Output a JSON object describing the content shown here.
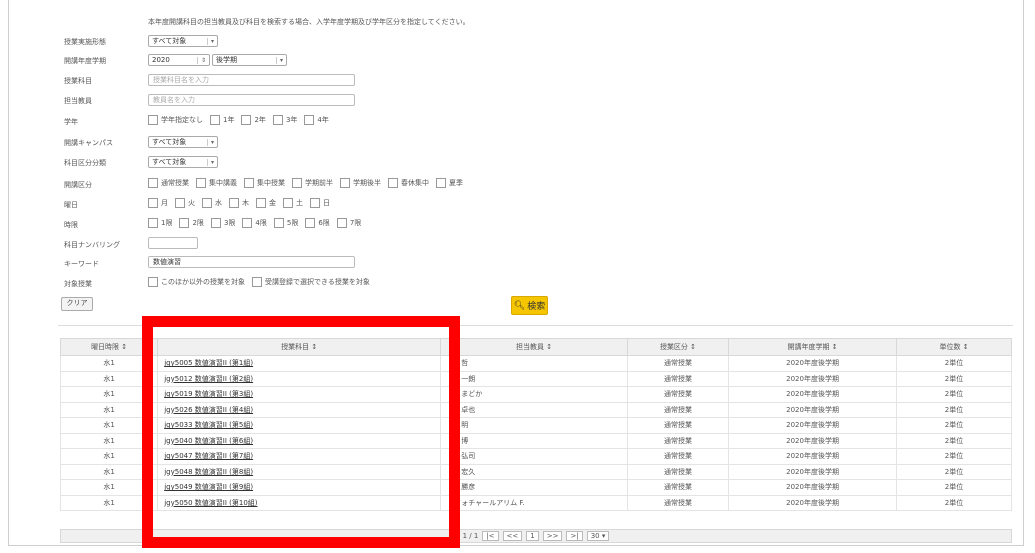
{
  "form": {
    "hint": "本年度開講科目の担当教員及び科目を検索する場合、入学年度学期及び学年区分を指定してください。",
    "labels": {
      "lesson_source": "授業実施形態",
      "year_term": "開講年度学期",
      "course_name": "授業科目",
      "teacher": "担当教員",
      "grade": "学年",
      "campus": "開講キャンパス",
      "category": "科目区分分類",
      "class_type": "開講区分",
      "weekday": "曜日",
      "period": "時限",
      "numbering": "科目ナンバリング",
      "keyword": "キーワード",
      "target": "対象授業"
    },
    "lesson_source_value": "すべて対象",
    "year_value": "2020",
    "term_value": "後学期",
    "course_placeholder": "授業科目名を入力",
    "teacher_placeholder": "教員名を入力",
    "grade_options": [
      "学年指定なし",
      "1年",
      "2年",
      "3年",
      "4年"
    ],
    "campus_value": "すべて対象",
    "category_value": "すべて対象",
    "class_type_options": [
      "通常授業",
      "集中講義",
      "集中授業",
      "学期前半",
      "学期後半",
      "春休集中",
      "夏季"
    ],
    "weekday_options": [
      "月",
      "火",
      "水",
      "木",
      "金",
      "土",
      "日"
    ],
    "period_options": [
      "1限",
      "2限",
      "3限",
      "4限",
      "5限",
      "6限",
      "7限"
    ],
    "keyword_value": "数値演習",
    "target_options": [
      "このほか以外の授業を対象",
      "受講登録で選択できる授業を対象"
    ],
    "clear_label": "クリア",
    "search_label": "検索"
  },
  "table": {
    "headers": [
      "曜日時限 ↕",
      "授業科目 ↕",
      "担当教員 ↕",
      "授業区分 ↕",
      "開講年度学期 ↕",
      "単位数 ↕"
    ],
    "rows": [
      {
        "slot": "水1",
        "course": "jgy5005 数値演習II (第1組)",
        "teacher": "　　哲",
        "type": "通常授業",
        "term": "2020年度後学期",
        "credits": "2単位"
      },
      {
        "slot": "水1",
        "course": "jgy5012 数値演習II (第2組)",
        "teacher": "　　一朗",
        "type": "通常授業",
        "term": "2020年度後学期",
        "credits": "2単位"
      },
      {
        "slot": "水1",
        "course": "jgy5019 数値演習II (第3組)",
        "teacher": "　　まどか",
        "type": "通常授業",
        "term": "2020年度後学期",
        "credits": "2単位"
      },
      {
        "slot": "水1",
        "course": "jgy5026 数値演習II (第4組)",
        "teacher": "　　卓也",
        "type": "通常授業",
        "term": "2020年度後学期",
        "credits": "2単位"
      },
      {
        "slot": "水1",
        "course": "jgy5033 数値演習II (第5組)",
        "teacher": "　　明",
        "type": "通常授業",
        "term": "2020年度後学期",
        "credits": "2単位"
      },
      {
        "slot": "水1",
        "course": "jgy5040 数値演習II (第6組)",
        "teacher": "　　博",
        "type": "通常授業",
        "term": "2020年度後学期",
        "credits": "2単位"
      },
      {
        "slot": "水1",
        "course": "jgy5047 数値演習II (第7組)",
        "teacher": "　　弘司",
        "type": "通常授業",
        "term": "2020年度後学期",
        "credits": "2単位"
      },
      {
        "slot": "水1",
        "course": "jgy5048 数値演習II (第8組)",
        "teacher": "　　宏久",
        "type": "通常授業",
        "term": "2020年度後学期",
        "credits": "2単位"
      },
      {
        "slot": "水1",
        "course": "jgy5049 数値演習II (第9組)",
        "teacher": "　　勝彦",
        "type": "通常授業",
        "term": "2020年度後学期",
        "credits": "2単位"
      },
      {
        "slot": "水1",
        "course": "jgy5050 数値演習II (第10組)",
        "teacher": "　フォチャールアリム F.",
        "type": "通常授業",
        "term": "2020年度後学期",
        "credits": "2単位"
      }
    ]
  },
  "pager": {
    "info": "1 / 1",
    "first": "|<",
    "prev": "<<",
    "page": "1",
    "next": ">>",
    "last": ">|",
    "per_page": "30"
  },
  "colors": {
    "highlight": "#ff0000",
    "search_button": "#f5c500"
  }
}
